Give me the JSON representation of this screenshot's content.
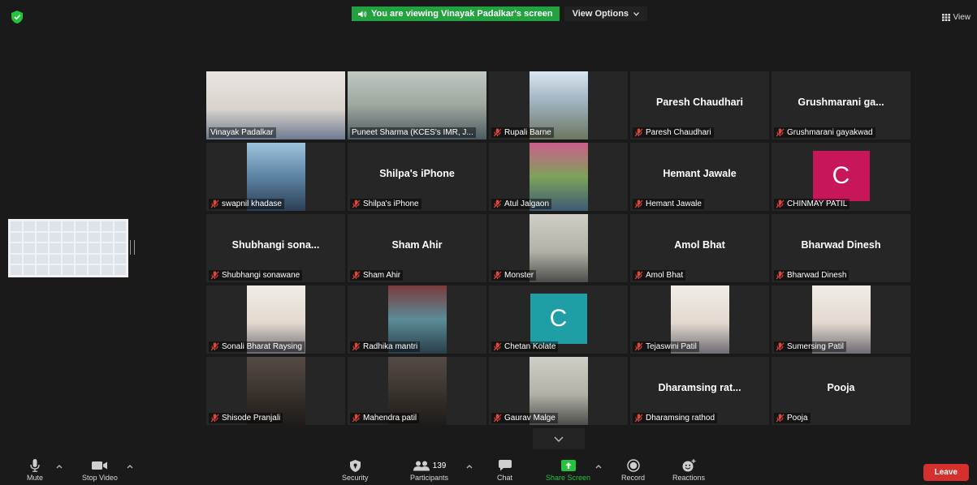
{
  "banner": {
    "text": "You are viewing Vinayak Padalkar's screen",
    "options_label": "View Options"
  },
  "view_label": "View",
  "participants": [
    {
      "name": "Vinayak Padalkar",
      "type": "video",
      "scene": "office",
      "muted": false
    },
    {
      "name": "Puneet Sharma (KCES's IMR, J...",
      "type": "video",
      "scene": "room",
      "muted": false,
      "active": true
    },
    {
      "name": "Rupali Barne",
      "type": "photo",
      "scene": "mountain",
      "muted": true
    },
    {
      "name": "Paresh Chaudhari",
      "type": "name",
      "display": "Paresh Chaudhari",
      "muted": true
    },
    {
      "name": "Grushmarani gayakwad",
      "type": "name",
      "display": "Grushmarani ga...",
      "muted": true
    },
    {
      "name": "swapnil khadase",
      "type": "photo",
      "scene": "blue",
      "muted": true
    },
    {
      "name": "Shilpa's iPhone",
      "type": "name",
      "display": "Shilpa's iPhone",
      "muted": true
    },
    {
      "name": "Atul Jalgaon",
      "type": "photo",
      "scene": "garden",
      "muted": true
    },
    {
      "name": "Hemant Jawale",
      "type": "name",
      "display": "Hemant Jawale",
      "muted": true
    },
    {
      "name": "CHINMAY PATIL",
      "type": "avatar",
      "letter": "C",
      "color": "#c8165a",
      "muted": true
    },
    {
      "name": "Shubhangi sonawane",
      "type": "name",
      "display": "Shubhangi sona...",
      "muted": true
    },
    {
      "name": "Sham Ahir",
      "type": "name",
      "display": "Sham Ahir",
      "muted": true
    },
    {
      "name": "Monster",
      "type": "photo",
      "scene": "wall",
      "muted": true
    },
    {
      "name": "Amol Bhat",
      "type": "name",
      "display": "Amol Bhat",
      "muted": true
    },
    {
      "name": "Bharwad Dinesh",
      "type": "name",
      "display": "Bharwad Dinesh",
      "muted": true
    },
    {
      "name": "Sonali Bharat Raysing",
      "type": "photo",
      "scene": "light",
      "muted": true
    },
    {
      "name": "Radhika mantri",
      "type": "photo",
      "scene": "teal",
      "muted": true
    },
    {
      "name": "Chetan Kolate",
      "type": "avatar",
      "letter": "C",
      "color": "#1f9ea6",
      "muted": true
    },
    {
      "name": "Tejaswini Patil",
      "type": "photo",
      "scene": "light",
      "muted": true
    },
    {
      "name": "Sumersing Patil",
      "type": "photo",
      "scene": "light",
      "muted": true
    },
    {
      "name": "Shisode Pranjali",
      "type": "photo",
      "scene": "dark",
      "muted": true
    },
    {
      "name": "Mahendra patil",
      "type": "photo",
      "scene": "dark",
      "muted": true
    },
    {
      "name": "Gaurav Malge",
      "type": "photo",
      "scene": "wall",
      "muted": true
    },
    {
      "name": "Dharamsing rathod",
      "type": "name",
      "display": "Dharamsing rat...",
      "muted": true
    },
    {
      "name": "Pooja",
      "type": "name",
      "display": "Pooja",
      "muted": true
    }
  ],
  "toolbar": {
    "mute": "Mute",
    "stop_video": "Stop Video",
    "security": "Security",
    "participants": "Participants",
    "participant_count": "139",
    "chat": "Chat",
    "share_screen": "Share Screen",
    "record": "Record",
    "reactions": "Reactions",
    "leave": "Leave"
  },
  "colors": {
    "accent_green": "#23a340",
    "leave_red": "#d5302d",
    "active_outline": "#c6e23a"
  }
}
